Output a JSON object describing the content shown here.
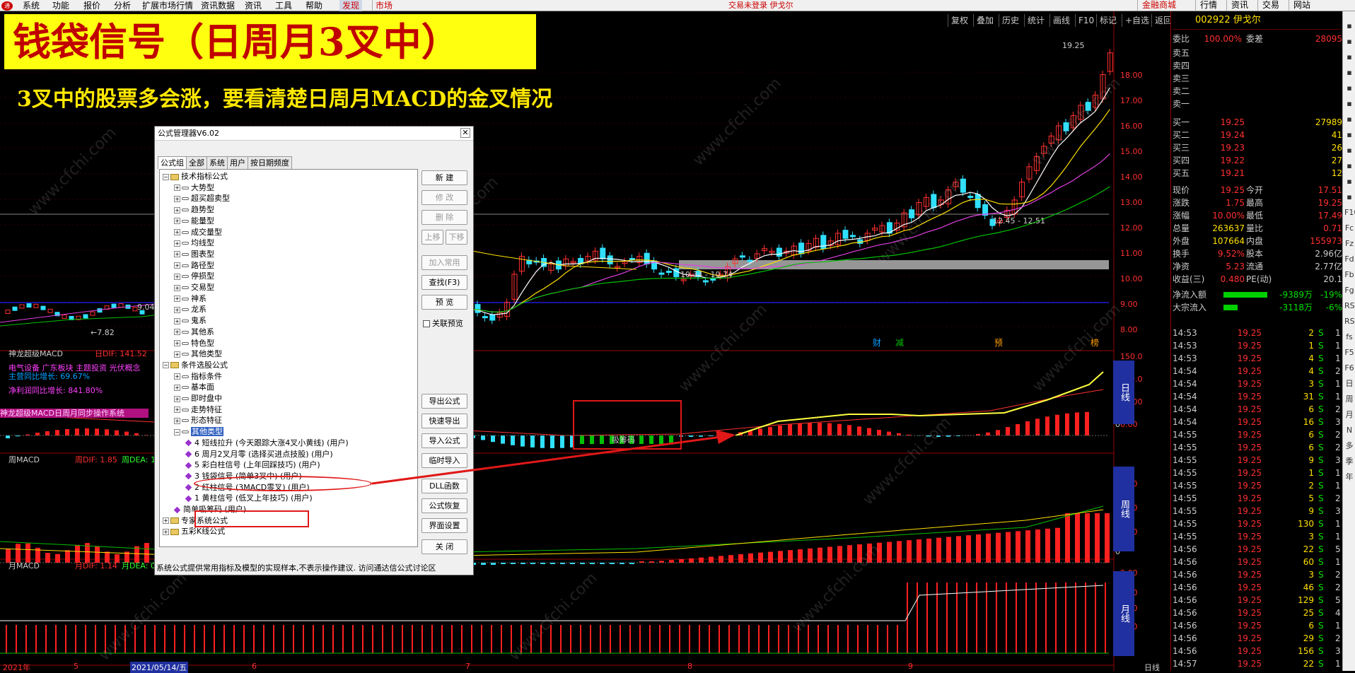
{
  "menubar": {
    "items": [
      "系统",
      "功能",
      "报价",
      "分析",
      "扩展市场行情",
      "资讯数据",
      "资讯",
      "工具",
      "帮助",
      "发现",
      "市场"
    ],
    "center_text": "交易未登录 伊戈尔",
    "right_buttons": [
      "金融商城",
      "行情",
      "资讯",
      "交易",
      "网站"
    ]
  },
  "toolbar": {
    "items": [
      "复权",
      "叠加",
      "历史",
      "统计",
      "画线",
      "F10",
      "标记",
      "+自选",
      "返回"
    ]
  },
  "banner": {
    "title": "钱袋信号（日周月3叉中）",
    "subtitle": "3叉中的股票多会涨，要看清楚日周月MACD的金叉情况"
  },
  "chart": {
    "price_labels": [
      "19.25",
      "12.45 - 12.51",
      "10.34 - 10.74",
      "←7.82",
      "9.04"
    ],
    "price_ticks": [
      "18.00",
      "17.00",
      "16.00",
      "15.00",
      "14.00",
      "13.00",
      "12.00",
      "11.00",
      "10.00",
      "9.00",
      "8.00"
    ],
    "event_markers": [
      "财",
      "减",
      "预",
      "榜"
    ],
    "macd_day": {
      "title": "神龙超级MACD",
      "dif": "日DIF: 141.52",
      "info1": "电气设备 广东板块 主题投资 光伏概念",
      "info2": "主营同比增长: 69.67%",
      "info3": "净利润同比增长: 841.80%",
      "banner": "神龙超级MACD日周月同步操作系统",
      "ticks": [
        "150.0",
        "100.0",
        "50.00",
        "0.00"
      ],
      "side": "日线",
      "zero": "0",
      "buy_text": "吸筹码"
    },
    "macd_week": {
      "title": "周MACD",
      "dif": "周DIF: 1.85",
      "dea": "周DEA: 1",
      "ticks": [
        "1.50",
        "1.00",
        "0.50"
      ],
      "side": "周线",
      "zero": "0"
    },
    "macd_month": {
      "title": "月MACD",
      "dif": "月DIF: 1.14",
      "dea": "月DEA: 0",
      "ticks": [
        "2.00",
        "1.50",
        "1.00",
        "0.50"
      ],
      "side": "月线",
      "zero": "0"
    },
    "xaxis": [
      "2021年",
      "5",
      "2021/05/14/五",
      "6",
      "7",
      "8",
      "9",
      "日线"
    ],
    "watermark": "www.cfchi.com"
  },
  "chart_data": {
    "type": "candlestick",
    "title": "钱袋信号（日周月3叉中）",
    "stock": "002922 伊戈尔",
    "y_ticks": [
      8,
      9,
      10,
      11,
      12,
      13,
      14,
      15,
      16,
      17,
      18
    ],
    "annotations": [
      "19.25",
      "12.45 - 12.51",
      "10.34 - 10.74",
      "7.82",
      "9.04"
    ]
  },
  "dialog": {
    "title": "公式管理器V6.02",
    "tabs": [
      "公式组",
      "全部",
      "系统",
      "用户",
      "按日期频度"
    ],
    "tree": [
      {
        "level": 0,
        "text": "技术指标公式",
        "exp": "−",
        "type": "folder"
      },
      {
        "level": 1,
        "text": "大势型",
        "exp": "+",
        "type": "node"
      },
      {
        "level": 1,
        "text": "超买超卖型",
        "exp": "+",
        "type": "node"
      },
      {
        "level": 1,
        "text": "趋势型",
        "exp": "+",
        "type": "node"
      },
      {
        "level": 1,
        "text": "能量型",
        "exp": "+",
        "type": "node"
      },
      {
        "level": 1,
        "text": "成交量型",
        "exp": "+",
        "type": "node"
      },
      {
        "level": 1,
        "text": "均线型",
        "exp": "+",
        "type": "node"
      },
      {
        "level": 1,
        "text": "图表型",
        "exp": "+",
        "type": "node"
      },
      {
        "level": 1,
        "text": "路径型",
        "exp": "+",
        "type": "node"
      },
      {
        "level": 1,
        "text": "停损型",
        "exp": "+",
        "type": "node"
      },
      {
        "level": 1,
        "text": "交易型",
        "exp": "+",
        "type": "node"
      },
      {
        "level": 1,
        "text": "神系",
        "exp": "+",
        "type": "node"
      },
      {
        "level": 1,
        "text": "龙系",
        "exp": "+",
        "type": "node"
      },
      {
        "level": 1,
        "text": "鬼系",
        "exp": "+",
        "type": "node"
      },
      {
        "level": 1,
        "text": "其他系",
        "exp": "+",
        "type": "node"
      },
      {
        "level": 1,
        "text": "特色型",
        "exp": "+",
        "type": "node"
      },
      {
        "level": 1,
        "text": "其他类型",
        "exp": "+",
        "type": "node"
      },
      {
        "level": 0,
        "text": "条件选股公式",
        "exp": "−",
        "type": "folder"
      },
      {
        "level": 1,
        "text": "指标条件",
        "exp": "+",
        "type": "node"
      },
      {
        "level": 1,
        "text": "基本面",
        "exp": "+",
        "type": "node"
      },
      {
        "level": 1,
        "text": "即时盘中",
        "exp": "+",
        "type": "node"
      },
      {
        "level": 1,
        "text": "走势特征",
        "exp": "+",
        "type": "node"
      },
      {
        "level": 1,
        "text": "形态特征",
        "exp": "+",
        "type": "node"
      },
      {
        "level": 1,
        "text": "其他类型",
        "exp": "−",
        "type": "node",
        "selected": true
      },
      {
        "level": 2,
        "text": "4  短线拉升   (今天跟踪大涨4叉小黄线) (用户)",
        "type": "leaf"
      },
      {
        "level": 2,
        "text": "6  周月2叉月零   (选择买进点技股) (用户)",
        "type": "leaf"
      },
      {
        "level": 2,
        "text": "5  彩白柱信号   (上年回踩技巧) (用户)",
        "type": "leaf"
      },
      {
        "level": 2,
        "text": "3  钱袋信号   (简单3叉中) (用户)",
        "type": "leaf"
      },
      {
        "level": 2,
        "text": "2  红柱信号   (3MACD零叉) (用户)",
        "type": "leaf"
      },
      {
        "level": 2,
        "text": "1  黄柱信号   (低叉上年技巧) (用户)",
        "type": "leaf"
      },
      {
        "level": 1,
        "text": "简单吸筹码   (用户)",
        "type": "leaf"
      },
      {
        "level": 0,
        "text": "专家系统公式",
        "exp": "+",
        "type": "folder"
      },
      {
        "level": 0,
        "text": "五彩K线公式",
        "exp": "+",
        "type": "folder"
      }
    ],
    "buttons": [
      "新  建",
      "修  改",
      "删  除",
      "上移",
      "下移",
      "加入常用",
      "查找(F3)",
      "预  览",
      "导出公式",
      "快速导出",
      "导入公式",
      "临时导入",
      "DLL函数",
      "公式恢复",
      "界面设置",
      "关  闭"
    ],
    "checkbox": "关联预览",
    "status": "系统公式提供常用指标及模型的实现样本,不表示操作建议.  访问通达信公式讨论区"
  },
  "quote": {
    "code": "002922 伊戈尔",
    "weibi": "委比",
    "weibi_val": "100.00%",
    "weicha": "委差",
    "weicha_val": "28095",
    "sells": [
      "卖五",
      "卖四",
      "卖三",
      "卖二",
      "卖一"
    ],
    "buys": [
      {
        "l": "买一",
        "p": "19.25",
        "v": "27989"
      },
      {
        "l": "买二",
        "p": "19.24",
        "v": "41"
      },
      {
        "l": "买三",
        "p": "19.23",
        "v": "26"
      },
      {
        "l": "买四",
        "p": "19.22",
        "v": "27"
      },
      {
        "l": "买五",
        "p": "19.21",
        "v": "12"
      }
    ],
    "stats": [
      {
        "a": "现价",
        "b": "19.25",
        "c": "今开",
        "d": "17.51"
      },
      {
        "a": "涨跌",
        "b": "1.75",
        "c": "最高",
        "d": "19.25"
      },
      {
        "a": "涨幅",
        "b": "10.00%",
        "c": "最低",
        "d": "17.49"
      },
      {
        "a": "总量",
        "b": "263637",
        "c": "量比",
        "d": "0.71"
      },
      {
        "a": "外盘",
        "b": "107664",
        "c": "内盘",
        "d": "155973"
      },
      {
        "a": "换手",
        "b": "9.52%",
        "c": "股本",
        "d": "2.96亿"
      },
      {
        "a": "净资",
        "b": "5.23",
        "c": "流通",
        "d": "2.77亿"
      },
      {
        "a": "收益(三)",
        "b": "0.480",
        "c": "PE(动)",
        "d": "20.1"
      }
    ],
    "flow": [
      {
        "a": "净流入额",
        "b": "-9389万",
        "c": "-19%"
      },
      {
        "a": "大宗流入",
        "b": "-3118万",
        "c": "-6%"
      }
    ],
    "ticks": [
      [
        "14:53",
        "19.25",
        "2",
        "S",
        "1"
      ],
      [
        "14:53",
        "19.25",
        "1",
        "S",
        "1"
      ],
      [
        "14:53",
        "19.25",
        "4",
        "S",
        "1"
      ],
      [
        "14:54",
        "19.25",
        "4",
        "S",
        "2"
      ],
      [
        "14:54",
        "19.25",
        "3",
        "S",
        "1"
      ],
      [
        "14:54",
        "19.25",
        "31",
        "S",
        "1"
      ],
      [
        "14:54",
        "19.25",
        "6",
        "S",
        "2"
      ],
      [
        "14:54",
        "19.25",
        "16",
        "S",
        "3"
      ],
      [
        "14:55",
        "19.25",
        "6",
        "S",
        "2"
      ],
      [
        "14:55",
        "19.25",
        "6",
        "S",
        "2"
      ],
      [
        "14:55",
        "19.25",
        "9",
        "S",
        "3"
      ],
      [
        "14:55",
        "19.25",
        "1",
        "S",
        "1"
      ],
      [
        "14:55",
        "19.25",
        "2",
        "S",
        "1"
      ],
      [
        "14:55",
        "19.25",
        "5",
        "S",
        "2"
      ],
      [
        "14:55",
        "19.25",
        "9",
        "S",
        "3"
      ],
      [
        "14:55",
        "19.25",
        "130",
        "S",
        "1"
      ],
      [
        "14:55",
        "19.25",
        "3",
        "S",
        "1"
      ],
      [
        "14:56",
        "19.25",
        "22",
        "S",
        "5"
      ],
      [
        "14:56",
        "19.25",
        "60",
        "S",
        "1"
      ],
      [
        "14:56",
        "19.25",
        "3",
        "S",
        "2"
      ],
      [
        "14:56",
        "19.25",
        "46",
        "S",
        "2"
      ],
      [
        "14:56",
        "19.25",
        "129",
        "S",
        "5"
      ],
      [
        "14:56",
        "19.25",
        "25",
        "S",
        "4"
      ],
      [
        "14:56",
        "19.25",
        "6",
        "S",
        "1"
      ],
      [
        "14:56",
        "19.25",
        "29",
        "S",
        "2"
      ],
      [
        "14:56",
        "19.25",
        "156",
        "S",
        "3"
      ],
      [
        "14:57",
        "19.25",
        "22",
        "S",
        "1"
      ]
    ]
  },
  "sidebar": {
    "icons": [
      "up-icon",
      "down-icon",
      "list-icon",
      "book-icon",
      "chart-icon",
      "grid-icon",
      "doc-icon",
      "doc-icon",
      "doc-icon",
      "tool-icon",
      "tool-icon",
      "tool-icon",
      "F10",
      "Fc",
      "Fz",
      "Fd",
      "Fb",
      "Fg",
      "RSI",
      "RSI",
      "fs",
      "F5",
      "F6",
      "日",
      "周",
      "月",
      "N",
      "多",
      "季",
      "年"
    ]
  }
}
